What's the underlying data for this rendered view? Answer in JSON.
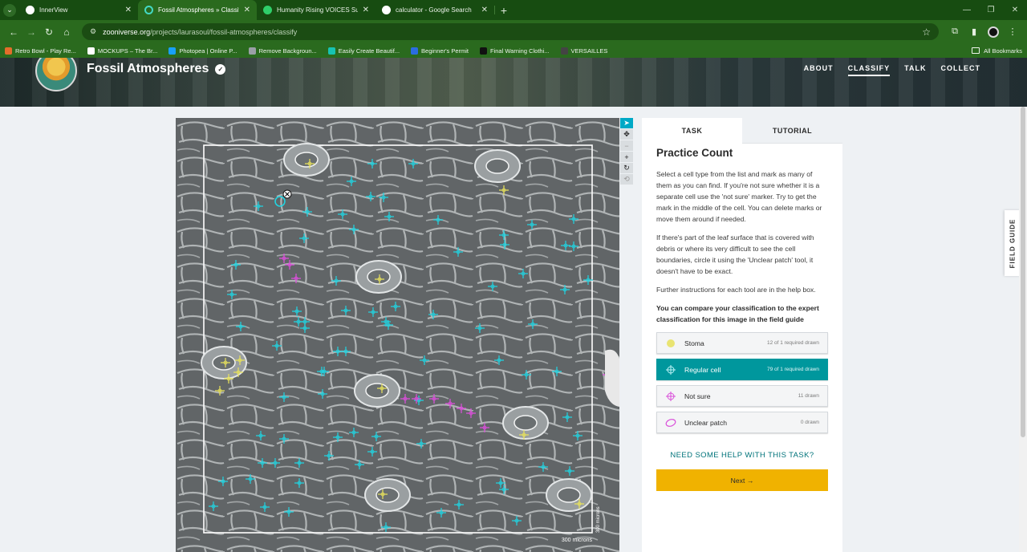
{
  "browser": {
    "tabs": [
      {
        "title": "InnerView",
        "favicon_color": "#ffffff",
        "active": false
      },
      {
        "title": "Fossil Atmospheres » Classify — Zooniverse",
        "favicon_color": "#43d9c4",
        "active": true
      },
      {
        "title": "Humanity Rising VOICES Survey",
        "favicon_color": "#2fcf6a",
        "active": false
      },
      {
        "title": "calculator - Google Search",
        "favicon_color": "#ffffff",
        "active": false
      }
    ],
    "url_host": "zooniverse.org",
    "url_path": "/projects/laurasoul/fossil-atmospheres/classify",
    "bookmarks": [
      {
        "label": "Retro Bowl - Play Re...",
        "color": "#e36d2b"
      },
      {
        "label": "MOCKUPS – The Br...",
        "color": "#ffffff"
      },
      {
        "label": "Photopea | Online P...",
        "color": "#18a0fb"
      },
      {
        "label": "Remove Backgroun...",
        "color": "#9aa0a6"
      },
      {
        "label": "Easily Create Beautif...",
        "color": "#17c3b2"
      },
      {
        "label": "Beginner's Permit",
        "color": "#2b6de0"
      },
      {
        "label": "Final Warning Clothi...",
        "color": "#111111"
      },
      {
        "label": "VERSAILLES",
        "color": "#444444"
      }
    ],
    "all_bookmarks": "All Bookmarks"
  },
  "project": {
    "title": "Fossil Atmospheres",
    "nav": [
      {
        "label": "ABOUT",
        "active": false
      },
      {
        "label": "CLASSIFY",
        "active": true
      },
      {
        "label": "TALK",
        "active": false
      },
      {
        "label": "COLLECT",
        "active": false
      }
    ]
  },
  "subject": {
    "scale_label": "300 microns",
    "scale_label_vertical": "300 microns"
  },
  "task": {
    "tabs": {
      "task": "TASK",
      "tutorial": "TUTORIAL"
    },
    "heading": "Practice Count",
    "paragraphs": [
      "Select a cell type from the list and mark as many of them as you can find. If you're not sure whether it is a separate cell use the 'not sure' marker. Try to get the mark in the middle of the cell. You can delete marks or move them around if needed.",
      "If there's part of the leaf surface that is covered with debris or where its very difficult to see the cell boundaries, circle it using the 'Unclear patch' tool, it doesn't have to be exact.",
      "Further instructions for each tool are in the help box."
    ],
    "bold_note": "You can compare your classification to the expert classification for this image in the field guide",
    "tools": [
      {
        "label": "Stoma",
        "count": "12 of 1 required drawn",
        "color": "#e6e05a",
        "icon": "circle-marker-icon",
        "active": false
      },
      {
        "label": "Regular cell",
        "count": "79 of 1 required drawn",
        "color": "#2ad4e0",
        "icon": "crosshair-marker-icon",
        "active": true
      },
      {
        "label": "Not sure",
        "count": "11 drawn",
        "color": "#d94fd9",
        "icon": "crosshair-marker-icon",
        "active": false
      },
      {
        "label": "Unclear patch",
        "count": "0 drawn",
        "color": "#d94fd9",
        "icon": "ellipse-marker-icon",
        "active": false
      }
    ],
    "help_link": "NEED SOME HELP WITH THIS TASK?",
    "next_label": "Next →"
  },
  "field_guide": "FIELD GUIDE",
  "colors": {
    "stoma": "#e8e25c",
    "regular": "#22d3e0",
    "not_sure": "#dd4fdd",
    "accent": "#00979d",
    "next": "#f0b200"
  }
}
